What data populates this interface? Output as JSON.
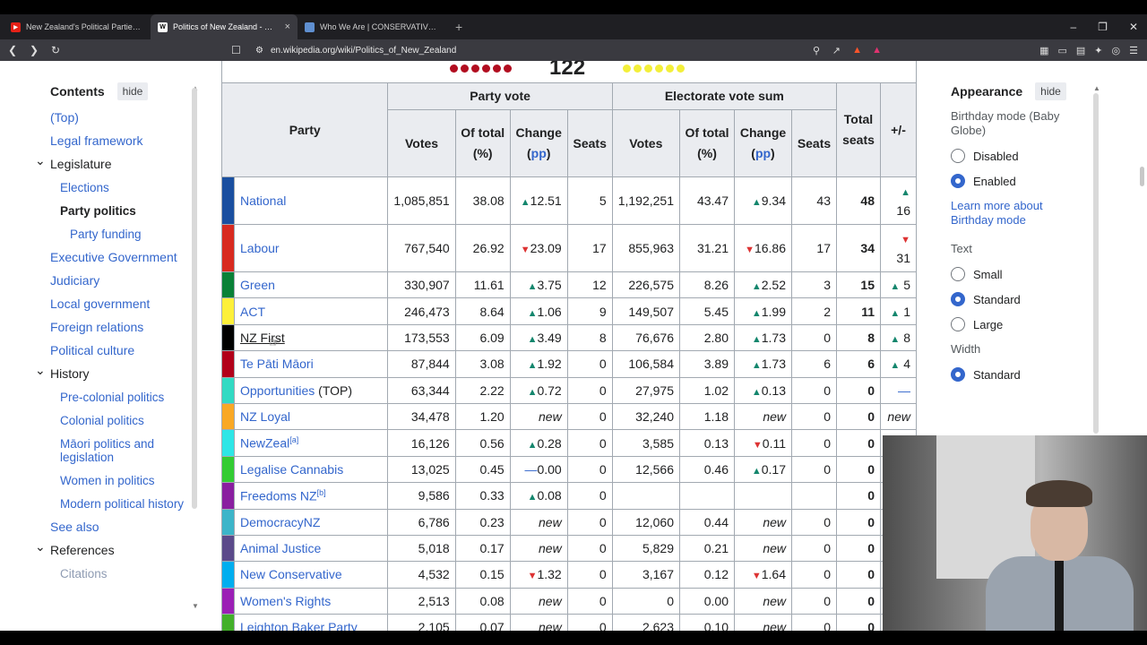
{
  "browser": {
    "tabs": [
      {
        "title": "New Zealand's Political Parties Explai",
        "icon": "youtube-icon",
        "color": "#e62117",
        "active": false
      },
      {
        "title": "Politics of New Zealand - Wikipe",
        "icon": "wikipedia-icon",
        "color": "#ffffff",
        "active": true
      },
      {
        "title": "Who We Are | CONSERVATIVES.NZ",
        "icon": "globe-icon",
        "color": "#5f8fd0",
        "active": false
      }
    ],
    "new_tab": "+",
    "url": "en.wikipedia.org/wiki/Politics_of_New_Zealand"
  },
  "toc": {
    "title": "Contents",
    "hide": "hide",
    "items": [
      {
        "label": "(Top)",
        "level": 1
      },
      {
        "label": "Legal framework",
        "level": 1
      },
      {
        "label": "Legislature",
        "level": 1,
        "expanded": true
      },
      {
        "label": "Elections",
        "level": 2
      },
      {
        "label": "Party politics",
        "level": 2,
        "current": true
      },
      {
        "label": "Party funding",
        "level": 3
      },
      {
        "label": "Executive Government",
        "level": 1
      },
      {
        "label": "Judiciary",
        "level": 1
      },
      {
        "label": "Local government",
        "level": 1
      },
      {
        "label": "Foreign relations",
        "level": 1
      },
      {
        "label": "Political culture",
        "level": 1
      },
      {
        "label": "History",
        "level": 1,
        "expanded": true
      },
      {
        "label": "Pre-colonial politics",
        "level": 2
      },
      {
        "label": "Colonial politics",
        "level": 2
      },
      {
        "label": "Māori politics and legislation",
        "level": 2
      },
      {
        "label": "Women in politics",
        "level": 2
      },
      {
        "label": "Modern political history",
        "level": 2
      },
      {
        "label": "See also",
        "level": 1
      },
      {
        "label": "References",
        "level": 1,
        "expanded": true
      },
      {
        "label": "Citations",
        "level": 2
      }
    ]
  },
  "table": {
    "seat_total": "122",
    "headers": {
      "party": "Party",
      "party_vote": "Party vote",
      "electorate": "Electorate vote sum",
      "votes": "Votes",
      "of_total": "Of total (%)",
      "change": "Change",
      "pp": "pp",
      "seats": "Seats",
      "total_seats": "Total seats",
      "plusminus": "+/-"
    },
    "rows": [
      {
        "color": "#1a4fa0",
        "party": "National",
        "pv": "1,085,851",
        "pp": "38.08",
        "pdir": "up",
        "pch": "12.51",
        "ps": "5",
        "ev": "1,192,251",
        "ep": "43.47",
        "edir": "up",
        "ech": "9.34",
        "es": "43",
        "total": "48",
        "pmdir": "up",
        "pm": "16"
      },
      {
        "color": "#d82a20",
        "party": "Labour",
        "pv": "767,540",
        "pp": "26.92",
        "pdir": "down",
        "pch": "23.09",
        "ps": "17",
        "ev": "855,963",
        "ep": "31.21",
        "edir": "down",
        "ech": "16.86",
        "es": "17",
        "total": "34",
        "pmdir": "down",
        "pm": "31"
      },
      {
        "color": "#098137",
        "party": "Green",
        "pv": "330,907",
        "pp": "11.61",
        "pdir": "up",
        "pch": "3.75",
        "ps": "12",
        "ev": "226,575",
        "ep": "8.26",
        "edir": "up",
        "ech": "2.52",
        "es": "3",
        "total": "15",
        "pmdir": "up",
        "pm": "5"
      },
      {
        "color": "#fdf03a",
        "party": "ACT",
        "pv": "246,473",
        "pp": "8.64",
        "pdir": "up",
        "pch": "1.06",
        "ps": "9",
        "ev": "149,507",
        "ep": "5.45",
        "edir": "up",
        "ech": "1.99",
        "es": "2",
        "total": "11",
        "pmdir": "up",
        "pm": "1"
      },
      {
        "color": "#000000",
        "party": "NZ First",
        "pv": "173,553",
        "pp": "6.09",
        "pdir": "up",
        "pch": "3.49",
        "ps": "8",
        "ev": "76,676",
        "ep": "2.80",
        "edir": "up",
        "ech": "1.73",
        "es": "0",
        "total": "8",
        "pmdir": "up",
        "pm": "8"
      },
      {
        "color": "#b2001a",
        "party": "Te Pāti Māori",
        "pv": "87,844",
        "pp": "3.08",
        "pdir": "up",
        "pch": "1.92",
        "ps": "0",
        "ev": "106,584",
        "ep": "3.89",
        "edir": "up",
        "ech": "1.73",
        "es": "6",
        "total": "6",
        "pmdir": "up",
        "pm": "4"
      },
      {
        "color": "#32dac3",
        "party": "Opportunities",
        "suffix": " (TOP)",
        "pv": "63,344",
        "pp": "2.22",
        "pdir": "up",
        "pch": "0.72",
        "ps": "0",
        "ev": "27,975",
        "ep": "1.02",
        "edir": "up",
        "ech": "0.13",
        "es": "0",
        "total": "0",
        "pmdir": "flat",
        "pm": "—"
      },
      {
        "color": "#f9a825",
        "party": "NZ Loyal",
        "pv": "34,478",
        "pp": "1.20",
        "pdir": "new",
        "pch": "new",
        "ps": "0",
        "ev": "32,240",
        "ep": "1.18",
        "edir": "new",
        "ech": "new",
        "es": "0",
        "total": "0",
        "pmdir": "new",
        "pm": "new"
      },
      {
        "color": "#2ee6e6",
        "party": "NewZeal",
        "sup": "[a]",
        "pv": "16,126",
        "pp": "0.56",
        "pdir": "up",
        "pch": "0.28",
        "ps": "0",
        "ev": "3,585",
        "ep": "0.13",
        "edir": "down",
        "ech": "0.11",
        "es": "0",
        "total": "0",
        "pmdir": "",
        "pm": ""
      },
      {
        "color": "#33cc33",
        "party": "Legalise Cannabis",
        "pv": "13,025",
        "pp": "0.45",
        "pdir": "flat",
        "pch": "0.00",
        "ps": "0",
        "ev": "12,566",
        "ep": "0.46",
        "edir": "up",
        "ech": "0.17",
        "es": "0",
        "total": "0",
        "pmdir": "",
        "pm": ""
      },
      {
        "color": "#8a1fa0",
        "party": "Freedoms NZ",
        "sup": "[b]",
        "pv": "9,586",
        "pp": "0.33",
        "pdir": "up",
        "pch": "0.08",
        "ps": "0",
        "ev": "",
        "ep": "",
        "edir": "",
        "ech": "",
        "es": "",
        "total": "0",
        "pmdir": "",
        "pm": ""
      },
      {
        "color": "#3cb5c9",
        "party": "DemocracyNZ",
        "pv": "6,786",
        "pp": "0.23",
        "pdir": "new",
        "pch": "new",
        "ps": "0",
        "ev": "12,060",
        "ep": "0.44",
        "edir": "new",
        "ech": "new",
        "es": "0",
        "total": "0",
        "pmdir": "",
        "pm": ""
      },
      {
        "color": "#5b4a8a",
        "party": "Animal Justice",
        "pv": "5,018",
        "pp": "0.17",
        "pdir": "new",
        "pch": "new",
        "ps": "0",
        "ev": "5,829",
        "ep": "0.21",
        "edir": "new",
        "ech": "new",
        "es": "0",
        "total": "0",
        "pmdir": "",
        "pm": ""
      },
      {
        "color": "#00aeef",
        "party": "New Conservative",
        "pv": "4,532",
        "pp": "0.15",
        "pdir": "down",
        "pch": "1.32",
        "ps": "0",
        "ev": "3,167",
        "ep": "0.12",
        "edir": "down",
        "ech": "1.64",
        "es": "0",
        "total": "0",
        "pmdir": "",
        "pm": ""
      },
      {
        "color": "#9b1fb5",
        "party": "Women's Rights",
        "pv": "2,513",
        "pp": "0.08",
        "pdir": "new",
        "pch": "new",
        "ps": "0",
        "ev": "0",
        "ep": "0.00",
        "edir": "new",
        "ech": "new",
        "es": "0",
        "total": "0",
        "pmdir": "",
        "pm": ""
      },
      {
        "color": "#43b02a",
        "party": "Leighton Baker Party",
        "pv": "2,105",
        "pp": "0.07",
        "pdir": "new",
        "pch": "new",
        "ps": "0",
        "ev": "2,623",
        "ep": "0.10",
        "edir": "new",
        "ech": "new",
        "es": "0",
        "total": "0",
        "pmdir": "",
        "pm": ""
      }
    ]
  },
  "appearance": {
    "title": "Appearance",
    "hide": "hide",
    "birthday_label": "Birthday mode (Baby Globe)",
    "birthday_options": [
      {
        "label": "Disabled",
        "checked": false
      },
      {
        "label": "Enabled",
        "checked": true
      }
    ],
    "learn_more": "Learn more about Birthday mode",
    "text_label": "Text",
    "text_options": [
      {
        "label": "Small",
        "checked": false
      },
      {
        "label": "Standard",
        "checked": true
      },
      {
        "label": "Large",
        "checked": false
      }
    ],
    "width_label": "Width",
    "width_options": [
      {
        "label": "Standard",
        "checked": true
      }
    ]
  },
  "colors": {
    "link": "#3366cc",
    "increase": "#14866d",
    "decrease": "#dd3333"
  }
}
